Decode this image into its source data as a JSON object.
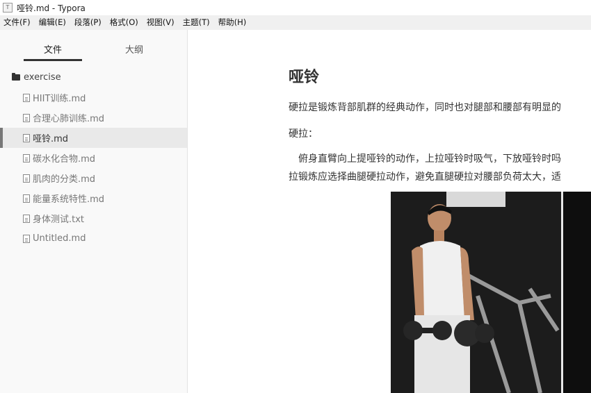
{
  "window": {
    "title": "哑铃.md - Typora",
    "app_icon": "typora-icon"
  },
  "menubar": {
    "items": [
      "文件(F)",
      "编辑(E)",
      "段落(P)",
      "格式(O)",
      "视图(V)",
      "主题(T)",
      "帮助(H)"
    ]
  },
  "sidebar": {
    "tabs": {
      "files": "文件",
      "outline": "大纲"
    },
    "folder": "exercise",
    "files": [
      "HIIT训练.md",
      "合理心肺训练.md",
      "哑铃.md",
      "碳水化合物.md",
      "肌肉的分类.md",
      "能量系统特性.md",
      "身体测试.txt",
      "Untitled.md"
    ],
    "active_file": "哑铃.md"
  },
  "document": {
    "heading": "哑铃",
    "para1": "硬拉是锻炼背部肌群的经典动作，同时也对腿部和腰部有明显的",
    "para2": "硬拉：",
    "para3_line1": "俯身直臂向上提哑铃的动作，上拉哑铃时吸气，下放哑铃时吗",
    "para3_line2": "拉锻炼应选择曲腿硬拉动作，避免直腿硬拉对腰部负荷太大，适"
  },
  "colors": {
    "active_indicator": "#777777",
    "tab_underline": "#333333",
    "sidebar_bg": "#f9f9f9"
  }
}
